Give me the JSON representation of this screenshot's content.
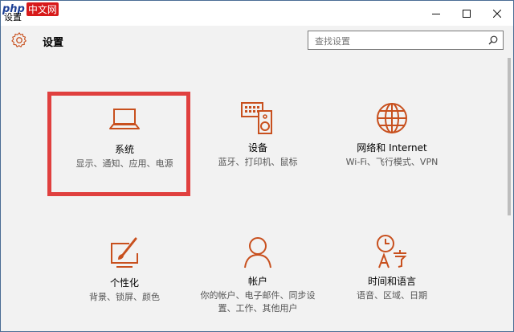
{
  "watermark": {
    "part1": "php",
    "part2": "中文网"
  },
  "window": {
    "title": "设置"
  },
  "header": {
    "title": "设置"
  },
  "search": {
    "placeholder": "查找设置"
  },
  "colors": {
    "accent": "#c8501e",
    "highlight": "#e0403f"
  },
  "tiles": [
    {
      "name": "系统",
      "desc": "显示、通知、应用、电源",
      "icon": "laptop-icon"
    },
    {
      "name": "设备",
      "desc": "蓝牙、打印机、鼠标",
      "icon": "devices-icon"
    },
    {
      "name": "网络和 Internet",
      "desc": "Wi-Fi、飞行模式、VPN",
      "icon": "globe-icon"
    },
    {
      "name": "个性化",
      "desc": "背景、锁屏、颜色",
      "icon": "personalization-icon"
    },
    {
      "name": "帐户",
      "desc": "你的帐户、电子邮件、同步设置、工作、其他用户",
      "icon": "account-icon"
    },
    {
      "name": "时间和语言",
      "desc": "语音、区域、日期",
      "icon": "time-language-icon"
    }
  ]
}
